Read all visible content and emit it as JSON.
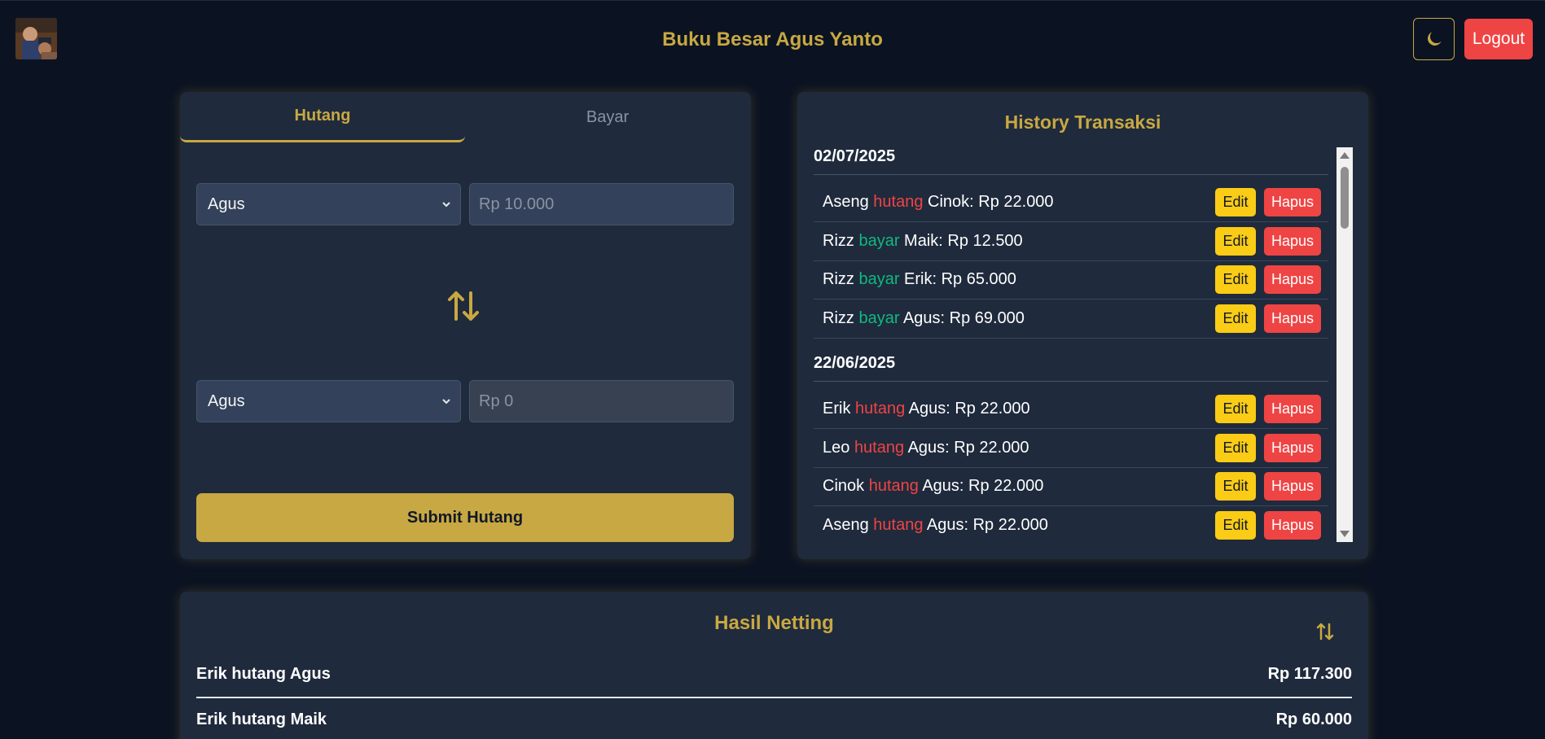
{
  "header": {
    "title": "Buku Besar Agus Yanto",
    "theme_icon": "moon-icon",
    "logout_label": "Logout"
  },
  "form": {
    "tabs": [
      {
        "label": "Hutang",
        "active": true
      },
      {
        "label": "Bayar",
        "active": false
      }
    ],
    "from_select": "Agus",
    "amount_placeholder": "Rp 10.000",
    "swap_icon": "swap-vertical-icon",
    "to_select": "Agus",
    "result_placeholder": "Rp 0",
    "submit_label": "Submit Hutang"
  },
  "history": {
    "title": "History Transaksi",
    "edit_label": "Edit",
    "delete_label": "Hapus",
    "groups": [
      {
        "date": "02/07/2025",
        "items": [
          {
            "from": "Aseng",
            "type": "hutang",
            "rest": "Cinok: Rp 22.000"
          },
          {
            "from": "Rizz",
            "type": "bayar",
            "rest": "Maik: Rp 12.500"
          },
          {
            "from": "Rizz",
            "type": "bayar",
            "rest": "Erik: Rp 65.000"
          },
          {
            "from": "Rizz",
            "type": "bayar",
            "rest": "Agus: Rp 69.000"
          }
        ]
      },
      {
        "date": "22/06/2025",
        "items": [
          {
            "from": "Erik",
            "type": "hutang",
            "rest": "Agus: Rp 22.000"
          },
          {
            "from": "Leo",
            "type": "hutang",
            "rest": "Agus: Rp 22.000"
          },
          {
            "from": "Cinok",
            "type": "hutang",
            "rest": "Agus: Rp 22.000"
          },
          {
            "from": "Aseng",
            "type": "hutang",
            "rest": "Agus: Rp 22.000"
          }
        ]
      }
    ]
  },
  "netting": {
    "title": "Hasil Netting",
    "rows": [
      {
        "label": "Erik hutang Agus",
        "amount": "Rp 117.300"
      },
      {
        "label": "Erik hutang Maik",
        "amount": "Rp 60.000"
      }
    ]
  },
  "colors": {
    "accent": "#c8a842",
    "background": "#0b1322",
    "card": "#1f2a3c",
    "danger": "#ef4444",
    "warning": "#facc15",
    "success": "#10b981"
  }
}
